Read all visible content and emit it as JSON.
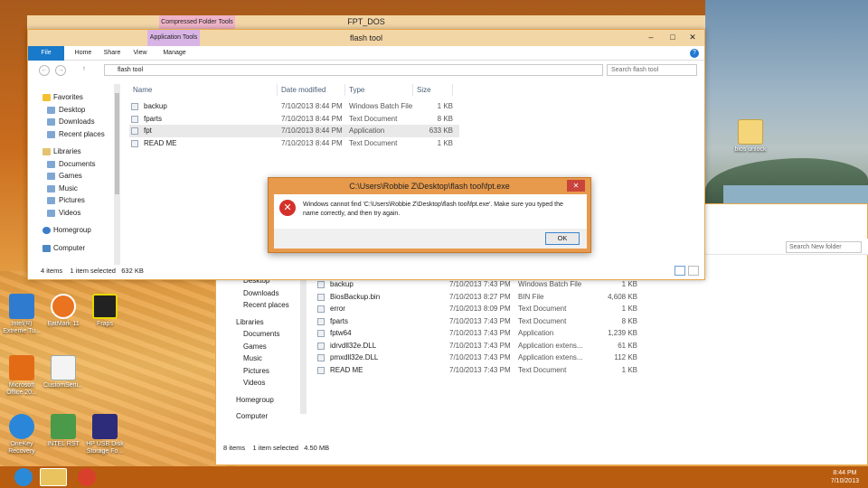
{
  "desktop_icons": [
    {
      "id": "intel-icon",
      "label": "Intel(R) Extreme Tu..."
    },
    {
      "id": "eatmark-icon",
      "label": "EatMark 11"
    },
    {
      "id": "fraps-icon",
      "label": "Fraps"
    },
    {
      "id": "office-icon",
      "label": "Microsoft Office 20..."
    },
    {
      "id": "custom-icon",
      "label": "CustomSetti..."
    },
    {
      "id": "onekey-icon",
      "label": "OneKey Recovery"
    },
    {
      "id": "intel-rst-icon",
      "label": "INTEL RST"
    },
    {
      "id": "hp-icon",
      "label": "HP USB Disk Storage Fo..."
    },
    {
      "id": "bios-folder",
      "label": "bios unlock"
    }
  ],
  "compressed_window": {
    "context_tab": "Compressed Folder Tools",
    "title": "FPT_DOS"
  },
  "front_window": {
    "context_tab": "Application Tools",
    "title": "flash tool",
    "tabs": {
      "file": "File",
      "home": "Home",
      "share": "Share",
      "view": "View",
      "manage": "Manage"
    },
    "address": "flash tool",
    "search_placeholder": "Search flash tool",
    "nav": {
      "favorites": "Favorites",
      "desktop": "Desktop",
      "downloads": "Downloads",
      "recent": "Recent places",
      "libraries": "Libraries",
      "documents": "Documents",
      "games": "Games",
      "music": "Music",
      "pictures": "Pictures",
      "videos": "Videos",
      "homegroup": "Homegroup",
      "computer": "Computer"
    },
    "columns": {
      "name": "Name",
      "date": "Date modified",
      "type": "Type",
      "size": "Size"
    },
    "files": [
      {
        "name": "backup",
        "date": "7/10/2013 8:44 PM",
        "type": "Windows Batch File",
        "size": "1 KB"
      },
      {
        "name": "fparts",
        "date": "7/10/2013 8:44 PM",
        "type": "Text Document",
        "size": "8 KB"
      },
      {
        "name": "fpt",
        "date": "7/10/2013 8:44 PM",
        "type": "Application",
        "size": "633 KB"
      },
      {
        "name": "READ ME",
        "date": "7/10/2013 8:44 PM",
        "type": "Text Document",
        "size": "1 KB"
      }
    ],
    "status": {
      "items": "4 items",
      "selected": "1 item selected",
      "size": "632 KB"
    }
  },
  "back_window": {
    "search_placeholder": "Search New folder",
    "nav": {
      "desktop": "Desktop",
      "downloads": "Downloads",
      "recent": "Recent places",
      "libraries": "Libraries",
      "documents": "Documents",
      "games": "Games",
      "music": "Music",
      "pictures": "Pictures",
      "videos": "Videos",
      "homegroup": "Homegroup",
      "computer": "Computer"
    },
    "files": [
      {
        "name": "backup",
        "date": "7/10/2013 7:43 PM",
        "type": "Windows Batch File",
        "size": "1 KB"
      },
      {
        "name": "BiosBackup.bin",
        "date": "7/10/2013 8:27 PM",
        "type": "BIN File",
        "size": "4,608 KB"
      },
      {
        "name": "error",
        "date": "7/10/2013 8:09 PM",
        "type": "Text Document",
        "size": "1 KB"
      },
      {
        "name": "fparts",
        "date": "7/10/2013 7:43 PM",
        "type": "Text Document",
        "size": "8 KB"
      },
      {
        "name": "fptw64",
        "date": "7/10/2013 7:43 PM",
        "type": "Application",
        "size": "1,239 KB"
      },
      {
        "name": "idrvdll32e.DLL",
        "date": "7/10/2013 7:43 PM",
        "type": "Application extens...",
        "size": "61 KB"
      },
      {
        "name": "pmxdll32e.DLL",
        "date": "7/10/2013 7:43 PM",
        "type": "Application extens...",
        "size": "112 KB"
      },
      {
        "name": "READ ME",
        "date": "7/10/2013 7:43 PM",
        "type": "Text Document",
        "size": "1 KB"
      }
    ],
    "status": {
      "items": "8 items",
      "selected": "1 item selected",
      "size": "4.50 MB"
    }
  },
  "dialog": {
    "title": "C:\\Users\\Robbie Z\\Desktop\\flash tool\\fpt.exe",
    "message": "Windows cannot find 'C:\\Users\\Robbie Z\\Desktop\\flash tool\\fpt.exe'. Make sure you typed the name correctly, and then try again.",
    "ok_label": "OK",
    "close_glyph": "✕"
  },
  "taskbar": {
    "time": "8:44 PM",
    "date": "7/10/2013"
  }
}
